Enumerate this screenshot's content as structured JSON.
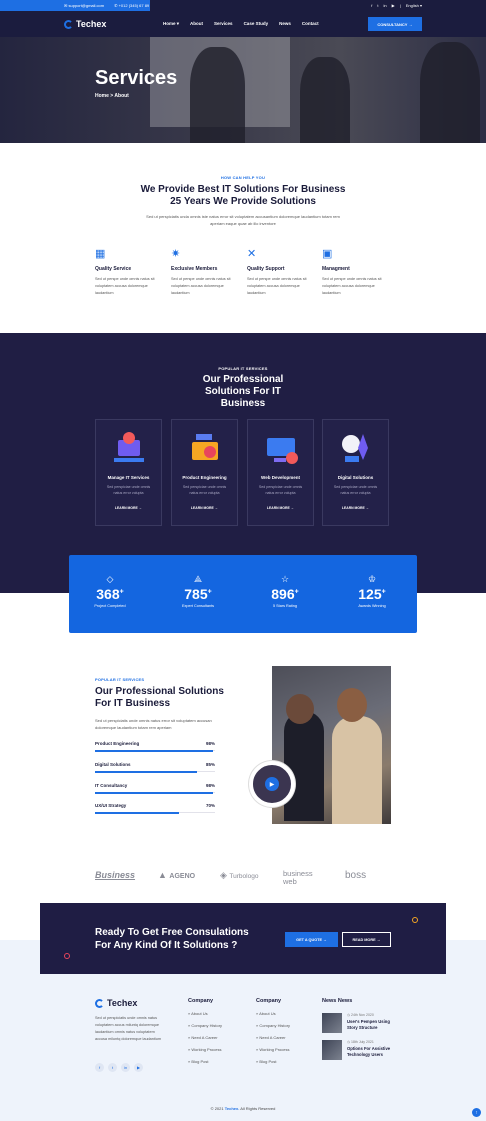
{
  "topbar": {
    "email": "support@gmail.com",
    "phone": "+012 (345) 67 89",
    "language": "English"
  },
  "nav": {
    "logo": "Techex",
    "menu": [
      "Home",
      "About",
      "Services",
      "Case Study",
      "News",
      "Contact"
    ],
    "cta": "CONSULTANCY"
  },
  "hero": {
    "title": "Services",
    "breadcrumb": "Home > About"
  },
  "intro": {
    "kicker": "HOW CAN HELP YOU",
    "title": "We Provide Best IT Solutions For Business 25 Years We Provide Solutions",
    "desc": "Sed ut perspiciatis unda omnis iste natus error sit voluptatem accusantium doloremque laudantium totam rem aperiam eaque quae ab illo inventore",
    "features": [
      {
        "icon": "chart-board-icon",
        "title": "Quality Service",
        "desc": "Sed ut perspe unde omnis natus sit voluptatem accusa doloremque laudantium"
      },
      {
        "icon": "gear-network-icon",
        "title": "Exclusive Members",
        "desc": "Sed ut perspe unde omnis natus sit voluptatem accusa doloremque laudantium"
      },
      {
        "icon": "tools-icon",
        "title": "Quality Support",
        "desc": "Sed ut perspe unde omnis natus sit voluptatem accusa doloremque laudantium"
      },
      {
        "icon": "monitor-chart-icon",
        "title": "Managment",
        "desc": "Sed ut perspe unde omnis natus sit voluptatem accusa doloremque laudantium"
      }
    ]
  },
  "solutions": {
    "kicker": "POPULAR IT SERVICES",
    "title": "Our Professional Solutions For IT Business",
    "cards": [
      {
        "title": "Manage IT Services",
        "desc": "Sed perspiciae unde omnis natus error volupta",
        "more": "LEARN MORE"
      },
      {
        "title": "Product Engineering",
        "desc": "Sed perspiciae unde omnis natus error volupta",
        "more": "LEARN MORE"
      },
      {
        "title": "Web Development",
        "desc": "Sed perspiciae unde omnis natus error volupta",
        "more": "LEARN MORE"
      },
      {
        "title": "Digital Solutions",
        "desc": "Sed perspiciae unde omnis natus error volupta",
        "more": "LEARN MORE"
      }
    ]
  },
  "stats": [
    {
      "icon": "diamond-icon",
      "value": "368",
      "label": "Project Completed"
    },
    {
      "icon": "compass-icon",
      "value": "785",
      "label": "Expert Consultants"
    },
    {
      "icon": "star-icon",
      "value": "896",
      "label": "5 Stars Rating"
    },
    {
      "icon": "trophy-icon",
      "value": "125",
      "label": "Awards Winning"
    }
  ],
  "skills": {
    "kicker": "POPULAR IT SERVICES",
    "title": "Our Professional Solutions For IT Business",
    "desc": "Sed ut perspiciatis unde omnis natus error sit voluptatem accusan doloremque laudantium totam rem aperiam",
    "bars": [
      {
        "label": "Product Engineering",
        "value": "98%",
        "percent": 98
      },
      {
        "label": "Digital Solutions",
        "value": "85%",
        "percent": 85
      },
      {
        "label": "IT Consultancy",
        "value": "98%",
        "percent": 98
      },
      {
        "label": "UX/UI Strategy",
        "value": "70%",
        "percent": 70
      }
    ]
  },
  "brands": [
    "Business",
    "AGENO",
    "Turbologo",
    "business web",
    "boss"
  ],
  "cta": {
    "title": "Ready To Get Free Consulations For Any Kind Of It Solutions ?",
    "primary": "GET A QUOTE",
    "secondary": "READ MORE"
  },
  "footer": {
    "logo": "Techex",
    "about": "Sed ut perspiciatis unde omnis natus voluptatem accus miluntq doloremque laudantium omnis natus voluptatem accusa miluntq doloremque laudantium",
    "col1": {
      "title": "Company",
      "links": [
        "About Us",
        "Company History",
        "Need A Career",
        "Working Process",
        "Blog Post"
      ]
    },
    "col2": {
      "title": "Company",
      "links": [
        "About Us",
        "Company History",
        "Need A Career",
        "Working Process",
        "Blog Post"
      ]
    },
    "news": {
      "title": "News News",
      "items": [
        {
          "date": "24th Nov 2020",
          "title": "User's Pempen Using Story Structure"
        },
        {
          "date": "18th July 2021",
          "title": "Options For Assistive Technology Users"
        }
      ]
    },
    "copyright_pre": "© 2021",
    "copyright_brand": "Techex.",
    "copyright_post": "All Rights Reserved"
  }
}
